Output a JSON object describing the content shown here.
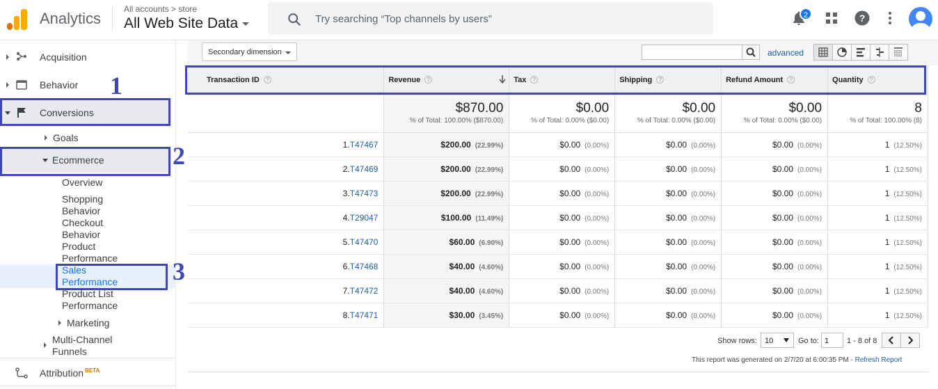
{
  "header": {
    "app_name": "Analytics",
    "breadcrumb": "All accounts > store",
    "property": "All Web Site Data",
    "search_placeholder": "Try searching “Top channels by users”",
    "notifications_count": "2"
  },
  "sidebar": {
    "acquisition": "Acquisition",
    "behavior": "Behavior",
    "conversions": "Conversions",
    "goals": "Goals",
    "ecommerce": "Ecommerce",
    "overview": "Overview",
    "shopping_1": "Shopping",
    "shopping_2": "Behavior",
    "checkout_1": "Checkout",
    "checkout_2": "Behavior",
    "product_1": "Product",
    "product_2": "Performance",
    "sales_1": "Sales",
    "sales_2": "Performance",
    "productlist_1": "Product List",
    "productlist_2": "Performance",
    "marketing": "Marketing",
    "multichannel_1": "Multi-Channel",
    "multichannel_2": "Funnels",
    "attribution": "Attribution",
    "beta": "BETA"
  },
  "annotations": [
    "1",
    "2",
    "3"
  ],
  "toolbar": {
    "secondary_dimension": "Secondary dimension",
    "advanced": "advanced"
  },
  "table": {
    "headers": [
      "Transaction ID",
      "Revenue",
      "Tax",
      "Shipping",
      "Refund Amount",
      "Quantity"
    ],
    "help": "?",
    "totals": [
      {
        "value": "$870.00",
        "sub": "% of Total: 100.00% ($870.00)"
      },
      {
        "value": "$0.00",
        "sub": "% of Total: 0.00% ($0.00)"
      },
      {
        "value": "$0.00",
        "sub": "% of Total: 0.00% ($0.00)"
      },
      {
        "value": "$0.00",
        "sub": "% of Total: 0.00% ($0.00)"
      },
      {
        "value": "8",
        "sub": "% of Total: 100.00% (8)"
      }
    ],
    "rows": [
      {
        "n": "1.",
        "id": "T47467",
        "revenue": "$200.00",
        "rev_pct": "(22.99%)",
        "tax": "$0.00",
        "tax_pct": "(0.00%)",
        "ship": "$0.00",
        "ship_pct": "(0.00%)",
        "refund": "$0.00",
        "refund_pct": "(0.00%)",
        "qty": "1",
        "qty_pct": "(12.50%)"
      },
      {
        "n": "2.",
        "id": "T47469",
        "revenue": "$200.00",
        "rev_pct": "(22.99%)",
        "tax": "$0.00",
        "tax_pct": "(0.00%)",
        "ship": "$0.00",
        "ship_pct": "(0.00%)",
        "refund": "$0.00",
        "refund_pct": "(0.00%)",
        "qty": "1",
        "qty_pct": "(12.50%)"
      },
      {
        "n": "3.",
        "id": "T47473",
        "revenue": "$200.00",
        "rev_pct": "(22.99%)",
        "tax": "$0.00",
        "tax_pct": "(0.00%)",
        "ship": "$0.00",
        "ship_pct": "(0.00%)",
        "refund": "$0.00",
        "refund_pct": "(0.00%)",
        "qty": "1",
        "qty_pct": "(12.50%)"
      },
      {
        "n": "4.",
        "id": "T29047",
        "revenue": "$100.00",
        "rev_pct": "(11.49%)",
        "tax": "$0.00",
        "tax_pct": "(0.00%)",
        "ship": "$0.00",
        "ship_pct": "(0.00%)",
        "refund": "$0.00",
        "refund_pct": "(0.00%)",
        "qty": "1",
        "qty_pct": "(12.50%)"
      },
      {
        "n": "5.",
        "id": "T47470",
        "revenue": "$60.00",
        "rev_pct": "(6.90%)",
        "tax": "$0.00",
        "tax_pct": "(0.00%)",
        "ship": "$0.00",
        "ship_pct": "(0.00%)",
        "refund": "$0.00",
        "refund_pct": "(0.00%)",
        "qty": "1",
        "qty_pct": "(12.50%)"
      },
      {
        "n": "6.",
        "id": "T47468",
        "revenue": "$40.00",
        "rev_pct": "(4.60%)",
        "tax": "$0.00",
        "tax_pct": "(0.00%)",
        "ship": "$0.00",
        "ship_pct": "(0.00%)",
        "refund": "$0.00",
        "refund_pct": "(0.00%)",
        "qty": "1",
        "qty_pct": "(12.50%)"
      },
      {
        "n": "7.",
        "id": "T47472",
        "revenue": "$40.00",
        "rev_pct": "(4.60%)",
        "tax": "$0.00",
        "tax_pct": "(0.00%)",
        "ship": "$0.00",
        "ship_pct": "(0.00%)",
        "refund": "$0.00",
        "refund_pct": "(0.00%)",
        "qty": "1",
        "qty_pct": "(12.50%)"
      },
      {
        "n": "8.",
        "id": "T47471",
        "revenue": "$30.00",
        "rev_pct": "(3.45%)",
        "tax": "$0.00",
        "tax_pct": "(0.00%)",
        "ship": "$0.00",
        "ship_pct": "(0.00%)",
        "refund": "$0.00",
        "refund_pct": "(0.00%)",
        "qty": "1",
        "qty_pct": "(12.50%)"
      }
    ]
  },
  "pagination": {
    "show_rows_label": "Show rows:",
    "rows_value": "10",
    "goto_label": "Go to:",
    "goto_value": "1",
    "range": "1 - 8 of 8"
  },
  "footer": {
    "generated": "This report was generated on 2/7/20 at 6:00:35 PM - ",
    "refresh": "Refresh Report"
  },
  "colors": {
    "annotation": "#3f48b0",
    "link": "#1a5ea8",
    "logo_orange": "#f9ab00",
    "logo_dark": "#e37400"
  }
}
